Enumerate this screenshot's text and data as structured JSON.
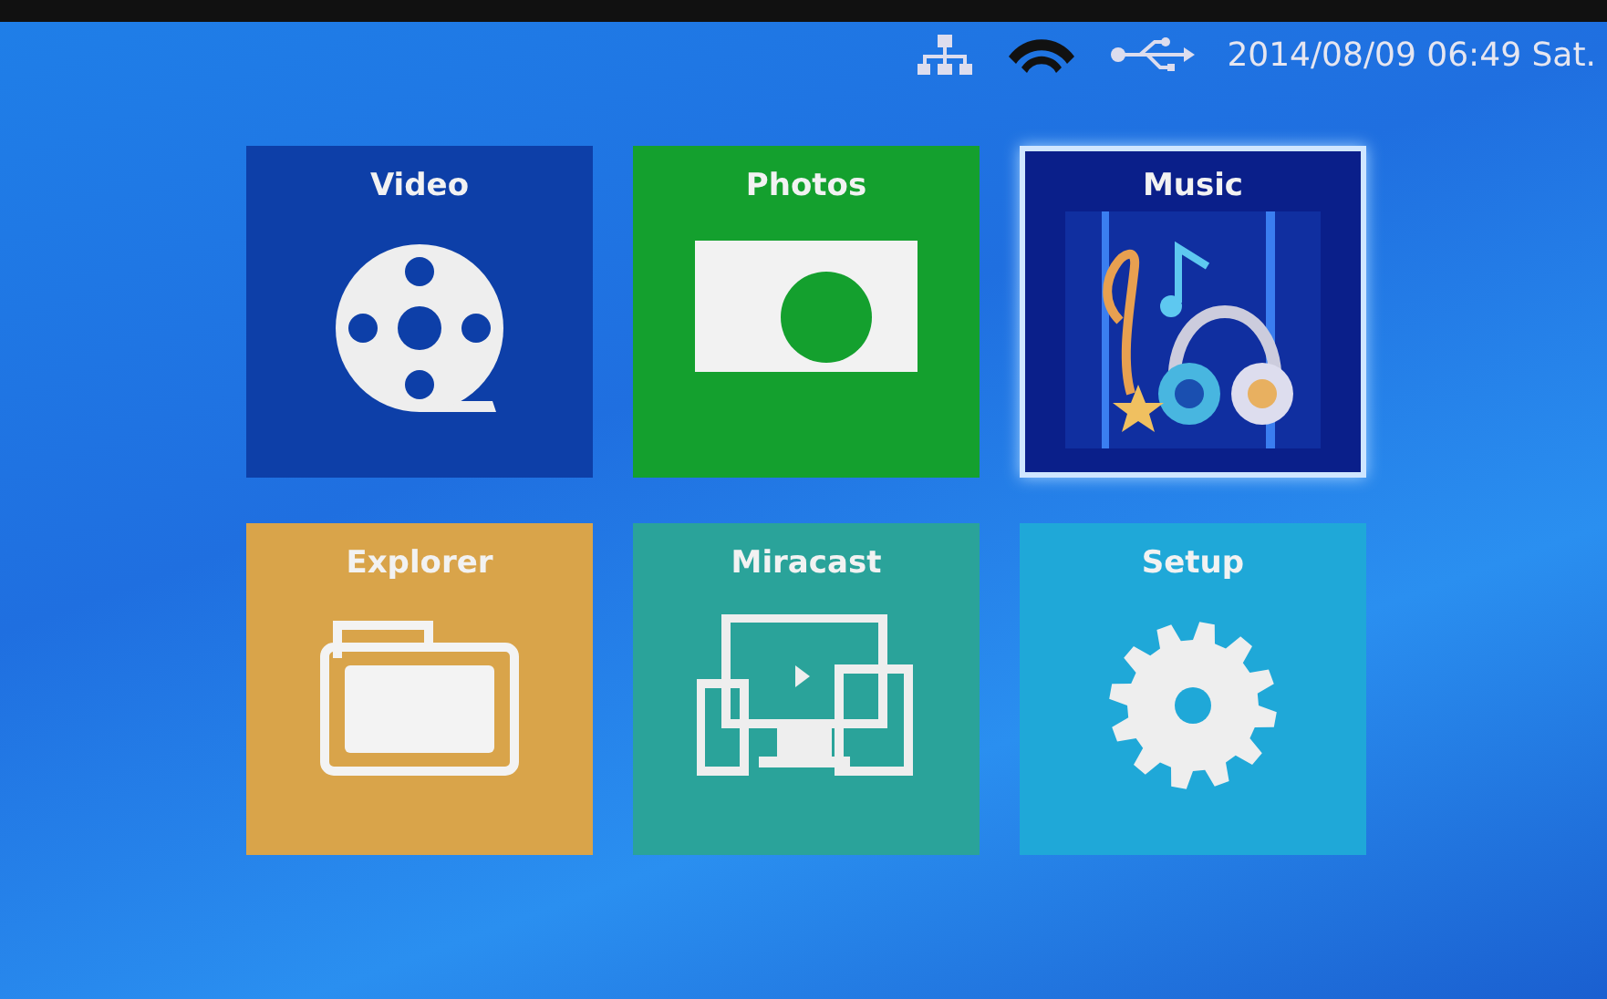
{
  "status_bar": {
    "datetime": "2014/08/09 06:49 Sat."
  },
  "tiles": [
    {
      "label": "Video",
      "kind": "video",
      "color": "#0d3fa8",
      "selected": false
    },
    {
      "label": "Photos",
      "kind": "photos",
      "color": "#14a02e",
      "selected": false
    },
    {
      "label": "Music",
      "kind": "music",
      "color": "#0a1f8a",
      "selected": true
    },
    {
      "label": "Explorer",
      "kind": "explorer",
      "color": "#d9a44a",
      "selected": false
    },
    {
      "label": "Miracast",
      "kind": "miracast",
      "color": "#2aa39a",
      "selected": false
    },
    {
      "label": "Setup",
      "kind": "setup",
      "color": "#1fa8d8",
      "selected": false
    }
  ]
}
